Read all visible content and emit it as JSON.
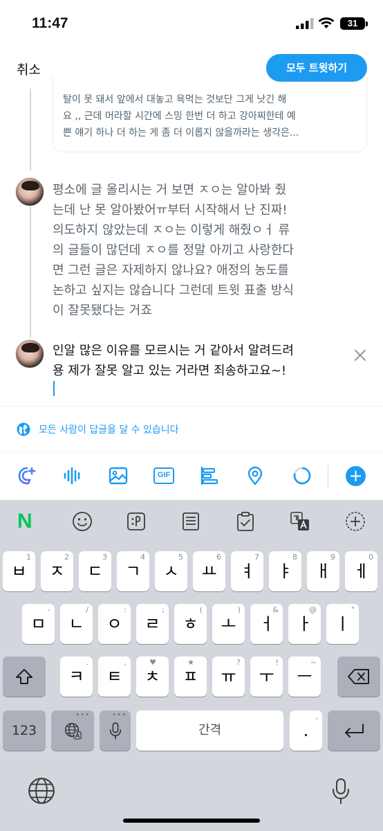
{
  "status_bar": {
    "time": "11:47",
    "battery": "31"
  },
  "header": {
    "cancel": "취소",
    "tweet_all": "모두 트윗하기"
  },
  "quoted_preview": {
    "lines": [
      "탈이 못 돼서 앞에서 대놓고 욕먹는 것보단 그게 낫긴 해",
      "요 ,, 근데 머라할 시간에 스밍 한번 더 하고 강아찌한테 예",
      "쁜 얘기 하나 더 하는 게 좀 더 이롭지 않을까라는 생각은..."
    ]
  },
  "tweet2": {
    "lines": [
      "평소에 글 올리시는 거 보면 ㅈㅇ는 알아봐 줬",
      "는데 난 못 알아봤어ㅠ부터 시작해서 난 진짜!",
      "의도하지 않았는데 ㅈㅇ는 이렇게 해줬ㅇㅓ 류",
      "의 글들이 많던데 ㅈㅇ를 정말 아끼고 사랑한다",
      "면 그런 글은 자제하지 않나요? 애정의 농도를",
      "논하고 싶지는 않습니다 그런데 트윗 표출 방식",
      "이 잘못됐다는 거죠"
    ]
  },
  "tweet3": {
    "lines": [
      "인알 많은 이유를 모르시는 거 같아서 알려드려",
      "용 제가 잘못 알고 있는 거라면 죄송하고요~!"
    ]
  },
  "reply_setting": {
    "label": "모든 사람이 답글을 달 수 있습니다"
  },
  "toolbar": {
    "gif": "GIF",
    "add": "+"
  },
  "keyboard": {
    "naver": "N",
    "row1": [
      {
        "char": "ㅂ",
        "hint": "1"
      },
      {
        "char": "ㅈ",
        "hint": "2"
      },
      {
        "char": "ㄷ",
        "hint": "3"
      },
      {
        "char": "ㄱ",
        "hint": "4"
      },
      {
        "char": "ㅅ",
        "hint": "5"
      },
      {
        "char": "ㅛ",
        "hint": "6"
      },
      {
        "char": "ㅕ",
        "hint": "7"
      },
      {
        "char": "ㅑ",
        "hint": "8"
      },
      {
        "char": "ㅐ",
        "hint": "9"
      },
      {
        "char": "ㅔ",
        "hint": "0"
      }
    ],
    "row2": [
      {
        "char": "ㅁ",
        "hint": "-"
      },
      {
        "char": "ㄴ",
        "hint": "/"
      },
      {
        "char": "ㅇ",
        "hint": ":"
      },
      {
        "char": "ㄹ",
        "hint": ";"
      },
      {
        "char": "ㅎ",
        "hint": "("
      },
      {
        "char": "ㅗ",
        "hint": ")"
      },
      {
        "char": "ㅓ",
        "hint": "&"
      },
      {
        "char": "ㅏ",
        "hint": "@"
      },
      {
        "char": "ㅣ",
        "hint": "\""
      }
    ],
    "row3": [
      {
        "char": "ㅋ",
        "hint": "."
      },
      {
        "char": "ㅌ",
        "hint": ","
      },
      {
        "char": "ㅊ",
        "hint": "♥"
      },
      {
        "char": "ㅍ",
        "hint": "★"
      },
      {
        "char": "ㅠ",
        "hint": "?"
      },
      {
        "char": "ㅜ",
        "hint": "!"
      },
      {
        "char": "ㅡ",
        "hint": "~"
      }
    ],
    "num_key": "123",
    "space": "간격",
    "period": ".",
    "period_hint": ","
  }
}
